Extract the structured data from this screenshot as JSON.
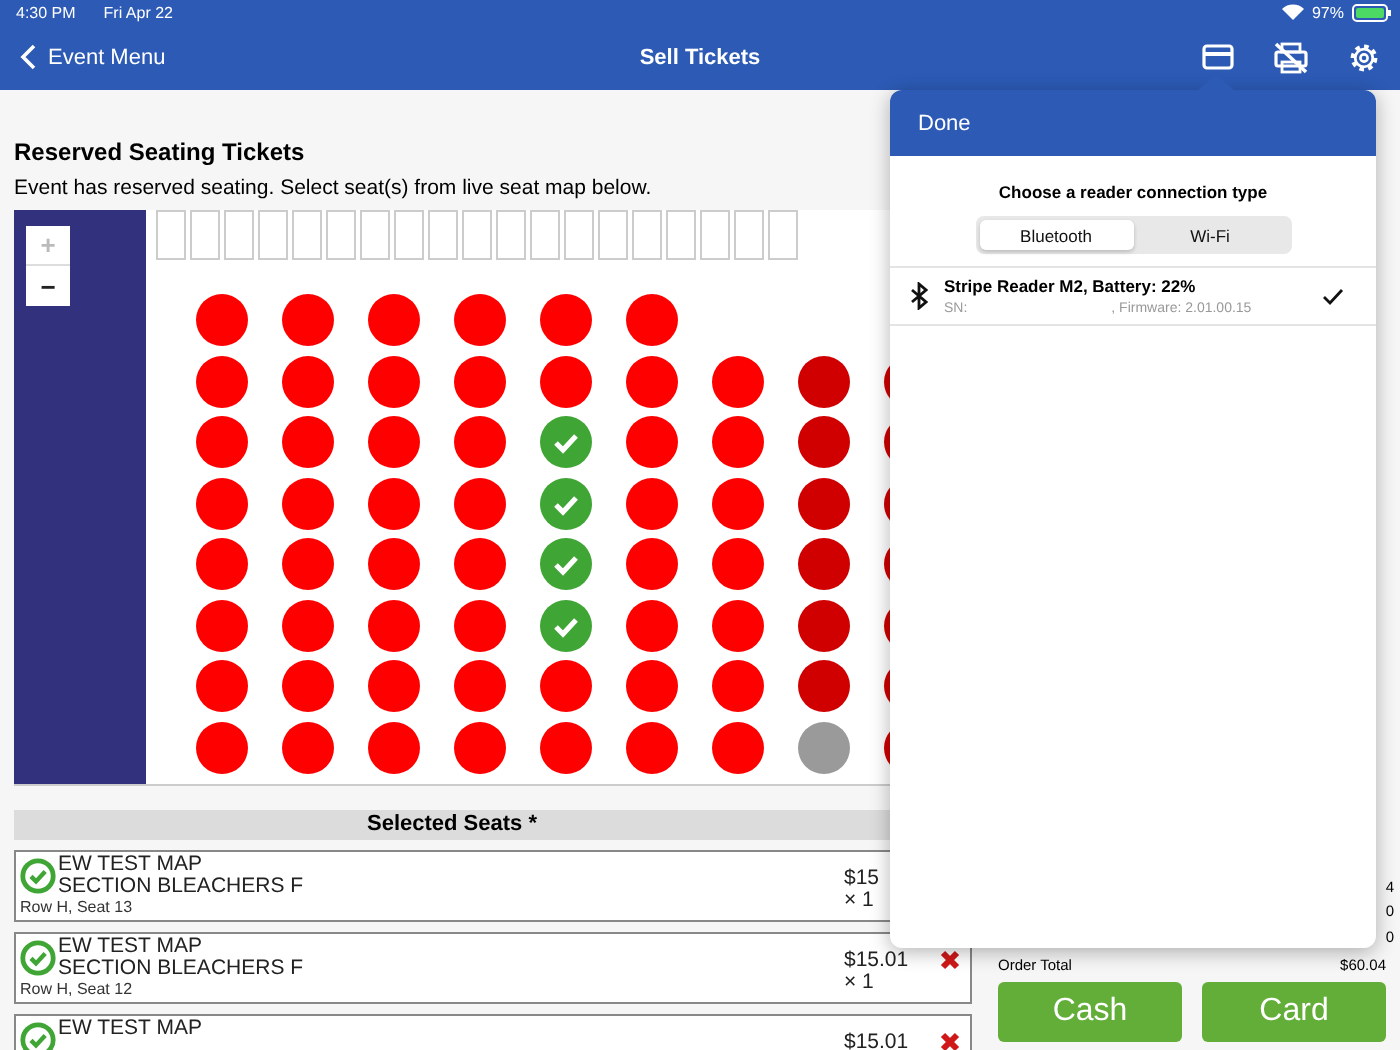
{
  "status_bar": {
    "time": "4:30 PM",
    "date": "Fri Apr 22",
    "battery": "97%"
  },
  "nav": {
    "back": "Event Menu",
    "title": "Sell Tickets"
  },
  "section": {
    "title": "Reserved Seating Tickets",
    "description": "Event has reserved seating. Select seat(s) from live seat map below."
  },
  "map": {
    "zoom_in": "+",
    "zoom_out": "−",
    "rows": [
      [
        {
          "kind": "sold"
        },
        {
          "kind": "sold"
        },
        {
          "kind": "sold"
        },
        {
          "kind": "sold"
        },
        {
          "kind": "sold"
        },
        {
          "kind": "sold"
        }
      ],
      [
        {
          "kind": "sold"
        },
        {
          "kind": "sold"
        },
        {
          "kind": "sold"
        },
        {
          "kind": "sold"
        },
        {
          "kind": "sold"
        },
        {
          "kind": "sold"
        },
        {
          "kind": "sold"
        },
        {
          "kind": "held"
        },
        {
          "kind": "held"
        }
      ],
      [
        {
          "kind": "sold"
        },
        {
          "kind": "sold"
        },
        {
          "kind": "sold"
        },
        {
          "kind": "sold"
        },
        {
          "kind": "selected"
        },
        {
          "kind": "sold"
        },
        {
          "kind": "sold"
        },
        {
          "kind": "held"
        },
        {
          "kind": "held"
        }
      ],
      [
        {
          "kind": "sold"
        },
        {
          "kind": "sold"
        },
        {
          "kind": "sold"
        },
        {
          "kind": "sold"
        },
        {
          "kind": "selected"
        },
        {
          "kind": "sold"
        },
        {
          "kind": "sold"
        },
        {
          "kind": "held"
        },
        {
          "kind": "held"
        }
      ],
      [
        {
          "kind": "sold"
        },
        {
          "kind": "sold"
        },
        {
          "kind": "sold"
        },
        {
          "kind": "sold"
        },
        {
          "kind": "selected"
        },
        {
          "kind": "sold"
        },
        {
          "kind": "sold"
        },
        {
          "kind": "held"
        },
        {
          "kind": "held"
        }
      ],
      [
        {
          "kind": "sold"
        },
        {
          "kind": "sold"
        },
        {
          "kind": "sold"
        },
        {
          "kind": "sold"
        },
        {
          "kind": "selected"
        },
        {
          "kind": "sold"
        },
        {
          "kind": "sold"
        },
        {
          "kind": "held"
        },
        {
          "kind": "held"
        }
      ],
      [
        {
          "kind": "sold"
        },
        {
          "kind": "sold"
        },
        {
          "kind": "sold"
        },
        {
          "kind": "sold"
        },
        {
          "kind": "sold"
        },
        {
          "kind": "sold"
        },
        {
          "kind": "sold"
        },
        {
          "kind": "held"
        },
        {
          "kind": "held"
        }
      ],
      [
        {
          "kind": "sold"
        },
        {
          "kind": "sold"
        },
        {
          "kind": "sold"
        },
        {
          "kind": "sold"
        },
        {
          "kind": "sold"
        },
        {
          "kind": "sold"
        },
        {
          "kind": "sold"
        },
        {
          "kind": "unavailable"
        },
        {
          "kind": "held"
        }
      ]
    ]
  },
  "selected_seats": {
    "title": "Selected Seats *",
    "items": [
      {
        "event": "EW TEST MAP",
        "section": "SECTION BLEACHERS F",
        "seat": "Row H, Seat 13",
        "price": "$15",
        "quantity": "× 1"
      },
      {
        "event": "EW TEST MAP",
        "section": "SECTION BLEACHERS F",
        "seat": "Row H, Seat 12",
        "price": "$15.01",
        "quantity": "× 1",
        "removable": true
      },
      {
        "event": "EW TEST MAP",
        "price": "$15.01",
        "removable": true
      }
    ]
  },
  "summary": {
    "lines": [
      "4",
      "0",
      "0"
    ],
    "total_label": "Order Total",
    "total": "$60.04",
    "buttons": [
      "Cash",
      "Card"
    ]
  },
  "popover": {
    "done": "Done",
    "title": "Choose a reader connection type",
    "segments": [
      {
        "label": "Bluetooth",
        "selected": true
      },
      {
        "label": "Wi-Fi",
        "selected": false
      }
    ],
    "readers": [
      {
        "name": "Stripe Reader M2, Battery: 22%",
        "serial_label": "SN:",
        "firmware": ", Firmware: 2.01.00.15",
        "checked": true
      }
    ]
  }
}
